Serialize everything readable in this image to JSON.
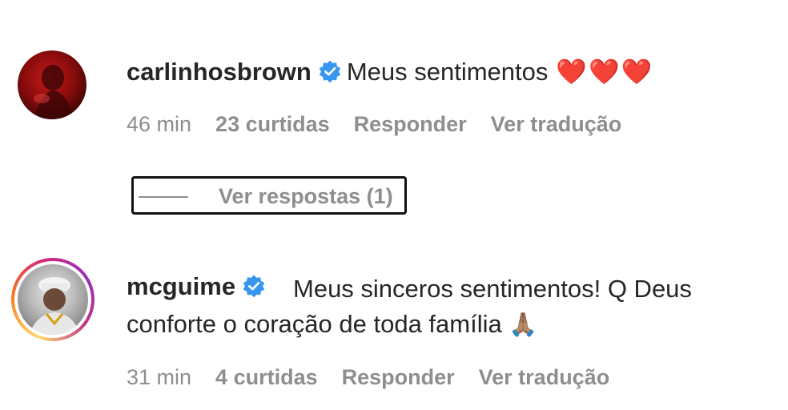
{
  "comments": [
    {
      "username": "carlinhosbrown",
      "verified": true,
      "text": "Meus sentimentos",
      "emoji": "❤️❤️❤️",
      "time": "46 min",
      "likes": "23 curtidas",
      "reply": "Responder",
      "translate": "Ver tradução",
      "view_replies": "Ver respostas (1)"
    },
    {
      "username": "mcguime",
      "verified": true,
      "text": "Meus sinceros sentimentos! Q Deus conforte o coração de toda família",
      "emoji": "🙏🏽",
      "time": "31 min",
      "likes": "4 curtidas",
      "reply": "Responder",
      "translate": "Ver tradução"
    }
  ],
  "colors": {
    "verified_blue": "#3797f0",
    "meta_gray": "#8e8e8e",
    "text": "#262626",
    "heart_red": "#e0141e"
  },
  "icons": {
    "verified": "verified-badge-icon"
  }
}
